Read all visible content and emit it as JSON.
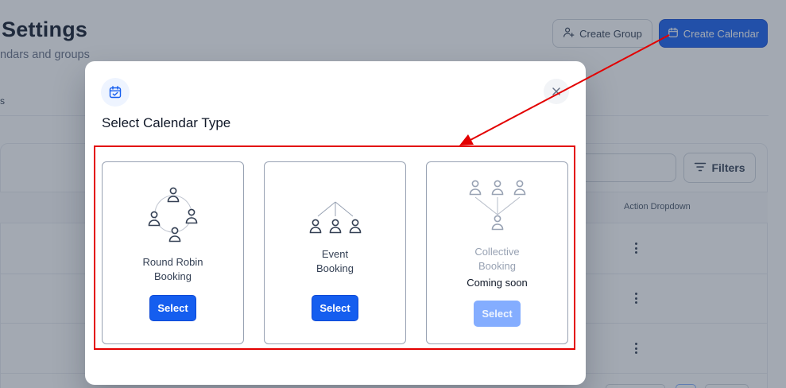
{
  "page": {
    "title": "Settings",
    "subtitle": "ndars and groups",
    "tab_fragment": "s"
  },
  "header_actions": {
    "create_group_label": "Create Group",
    "create_calendar_label": "Create Calendar"
  },
  "table": {
    "filters_label": "Filters",
    "action_column_header": "Action Dropdown"
  },
  "modal": {
    "header_icon": "calendar-check-icon",
    "title": "Select Calendar Type",
    "close_icon": "close-icon",
    "options": [
      {
        "icon": "round-robin-icon",
        "label_line1": "Round Robin",
        "label_line2": "Booking",
        "button": "Select",
        "enabled": true
      },
      {
        "icon": "event-booking-icon",
        "label_line1": "Event",
        "label_line2": "Booking",
        "button": "Select",
        "enabled": true
      },
      {
        "icon": "collective-booking-icon",
        "label_line1": "Collective",
        "label_line2": "Booking",
        "status": "Coming soon",
        "button": "Select",
        "enabled": false
      }
    ]
  },
  "colors": {
    "primary": "#155eef",
    "primary_disabled": "#84adff",
    "annotation_red": "#e30000",
    "overlay": "rgba(52, 64, 84, 0.45)"
  }
}
